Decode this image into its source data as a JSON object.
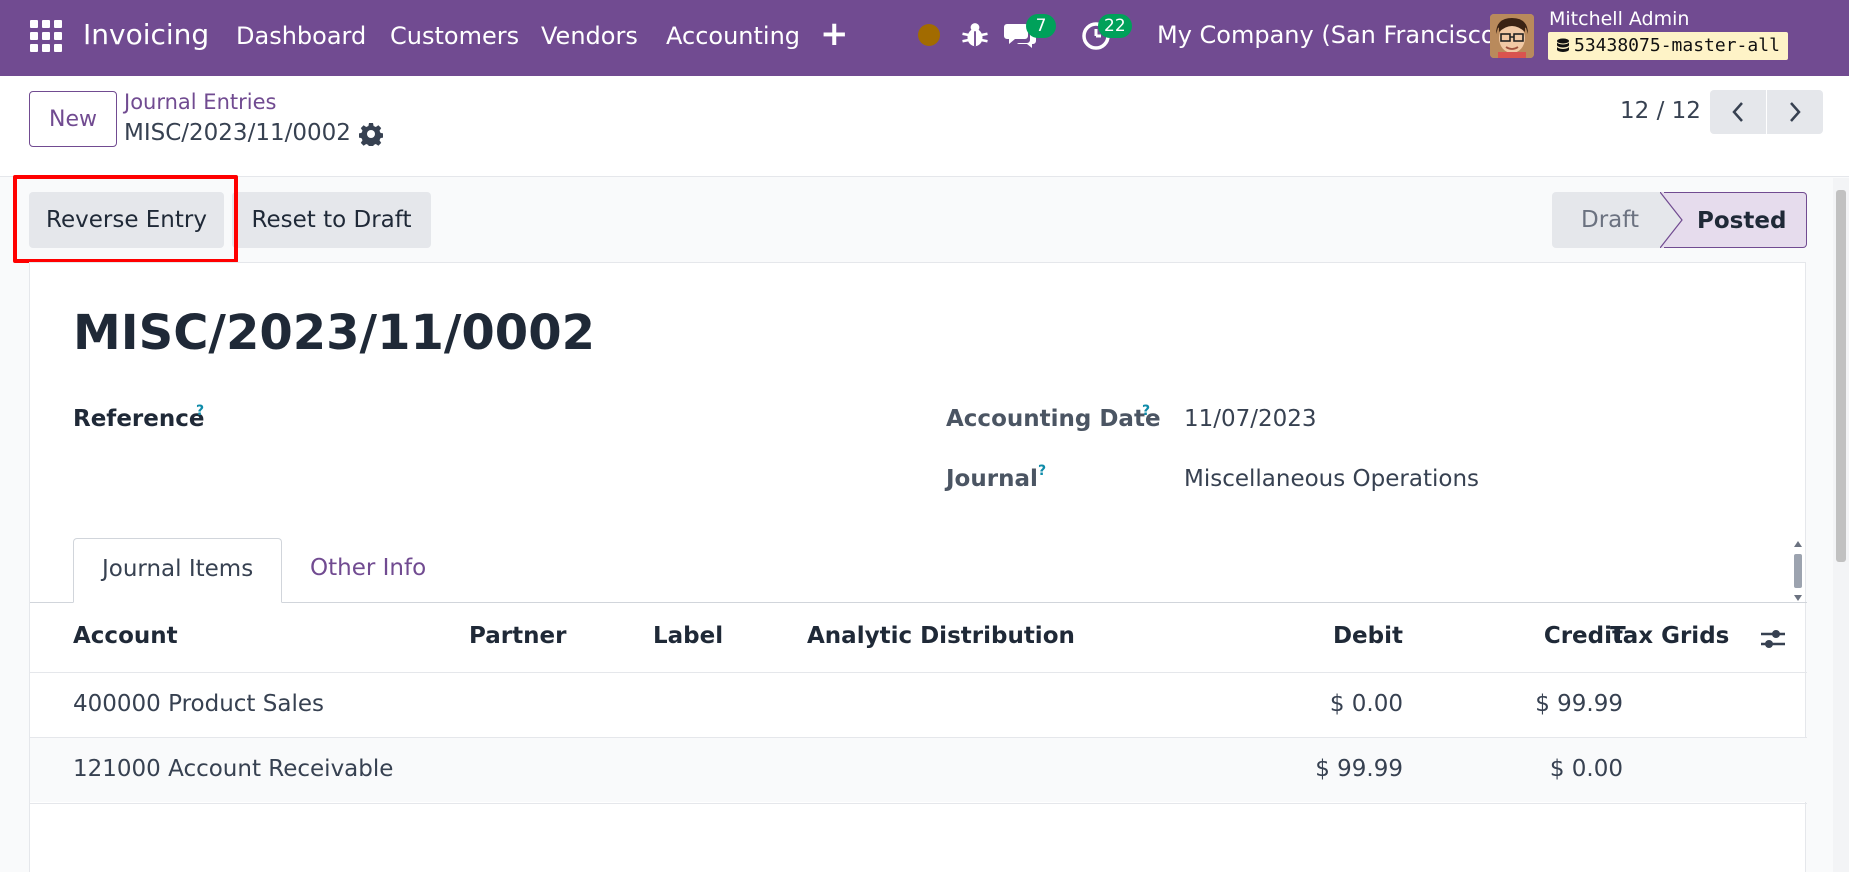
{
  "navbar": {
    "app_name": "Invoicing",
    "menu": [
      "Dashboard",
      "Customers",
      "Vendors",
      "Accounting"
    ],
    "messages_count": "7",
    "activities_count": "22",
    "company": "My Company (San Francisco)",
    "user_name": "Mitchell Admin",
    "database": "53438075-master-all",
    "colors": {
      "brand": "#714b91",
      "badge": "#00a15a",
      "status_dot": "#a26b00"
    }
  },
  "control_panel": {
    "new_label": "New",
    "breadcrumb_parent": "Journal Entries",
    "record_name": "MISC/2023/11/0002",
    "pager": "12 / 12"
  },
  "actions": {
    "reverse_label": "Reverse Entry",
    "reset_label": "Reset to Draft"
  },
  "statusbar": {
    "stages": [
      "Draft",
      "Posted"
    ],
    "current": "Posted"
  },
  "form": {
    "title": "MISC/2023/11/0002",
    "reference_label": "Reference",
    "reference_value": "",
    "accounting_date_label": "Accounting Date",
    "accounting_date": "11/07/2023",
    "journal_label": "Journal",
    "journal": "Miscellaneous Operations",
    "help_mark": "?"
  },
  "tabs": [
    "Journal Items",
    "Other Info"
  ],
  "table": {
    "columns": [
      "Account",
      "Partner",
      "Label",
      "Analytic Distribution",
      "Debit",
      "Credit",
      "Tax Grids"
    ],
    "rows": [
      {
        "account": "400000 Product Sales",
        "partner": "",
        "label": "",
        "analytic": "",
        "debit": "$ 0.00",
        "credit": "$ 99.99",
        "tax_grids": ""
      },
      {
        "account": "121000 Account Receivable",
        "partner": "",
        "label": "",
        "analytic": "",
        "debit": "$ 99.99",
        "credit": "$ 0.00",
        "tax_grids": ""
      }
    ]
  }
}
